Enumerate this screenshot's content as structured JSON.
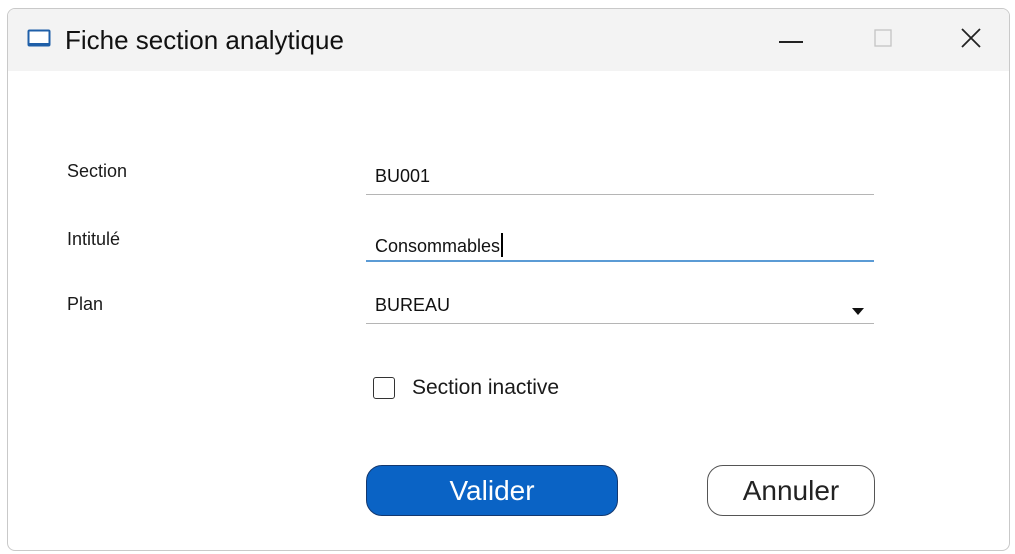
{
  "window": {
    "title": "Fiche section analytique",
    "icon": "window-app-icon",
    "controls": [
      "minimize-icon",
      "maximize-icon",
      "close-icon"
    ]
  },
  "form": {
    "section": {
      "label": "Section",
      "value": "BU001"
    },
    "intitule": {
      "label": "Intitulé",
      "value": "Consommables"
    },
    "plan": {
      "label": "Plan",
      "value": "BUREAU"
    },
    "inactive": {
      "label": "Section inactive",
      "checked": false
    }
  },
  "buttons": {
    "ok": "Valider",
    "cancel": "Annuler"
  },
  "colors": {
    "primary_button": "#0a63c5",
    "focus_underline": "#5b9bd5",
    "titlebar": "#f3f3f3"
  }
}
